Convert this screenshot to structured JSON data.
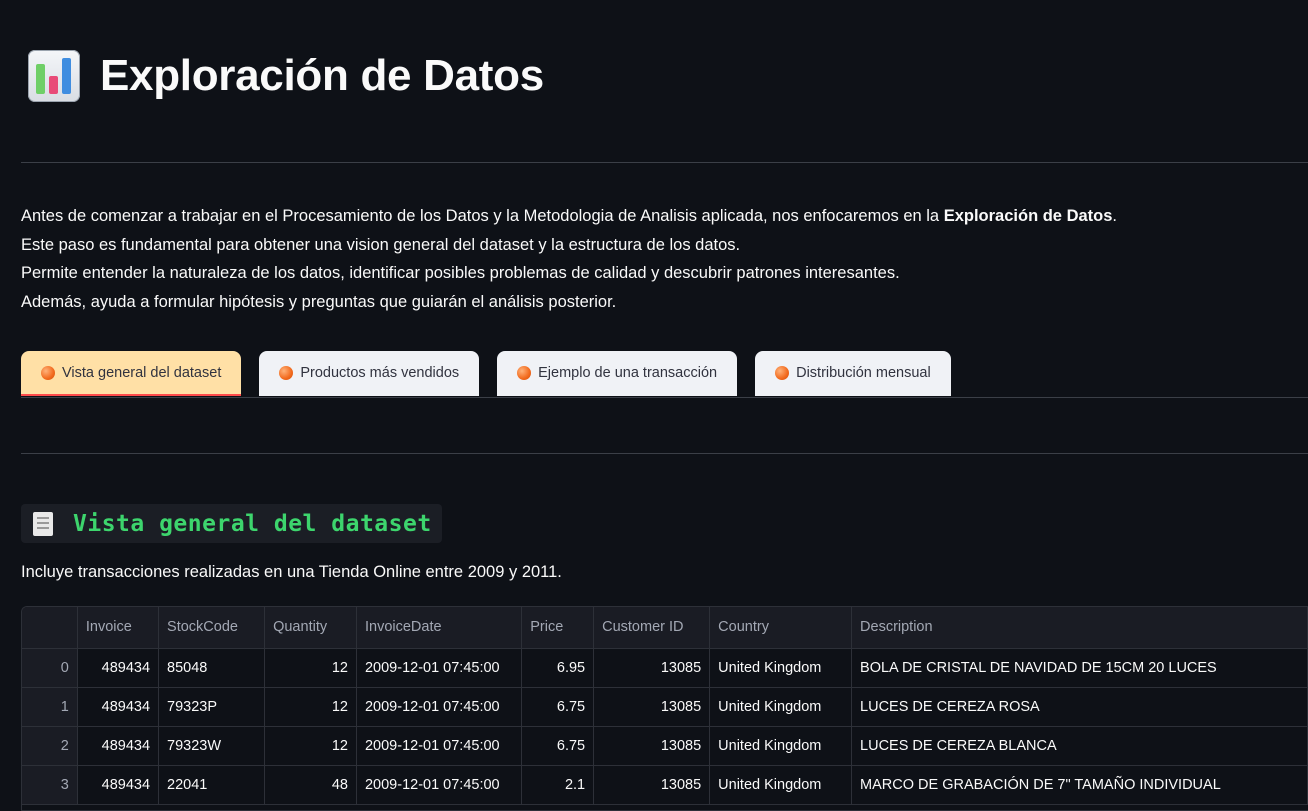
{
  "header": {
    "title": "Exploración de Datos",
    "icon": "bar-chart-icon"
  },
  "intro": {
    "line1_pre": "Antes de comenzar a trabajar en el Procesamiento de los Datos y la Metodologia de Analisis aplicada, nos enfocaremos en la ",
    "line1_bold": "Exploración de Datos",
    "line1_post": ".",
    "line2": "Este paso es fundamental para obtener una vision general del dataset y la estructura de los datos.",
    "line3": "Permite entender la naturaleza de los datos, identificar posibles problemas de calidad y descubrir patrones interesantes.",
    "line4": "Además, ayuda a formular hipótesis y preguntas que guiarán el análisis posterior."
  },
  "tabs": [
    {
      "label": "Vista general del dataset",
      "active": true
    },
    {
      "label": "Productos más vendidos",
      "active": false
    },
    {
      "label": "Ejemplo de una transacción",
      "active": false
    },
    {
      "label": "Distribución mensual",
      "active": false
    }
  ],
  "section": {
    "title": "Vista general del dataset",
    "icon": "receipt-icon",
    "caption": "Incluye transacciones realizadas en una Tienda Online entre 2009 y 2011."
  },
  "table": {
    "columns": [
      "",
      "Invoice",
      "StockCode",
      "Quantity",
      "InvoiceDate",
      "Price",
      "Customer ID",
      "Country",
      "Description"
    ],
    "rows": [
      [
        "0",
        "489434",
        "85048",
        "12",
        "2009-12-01 07:45:00",
        "6.95",
        "13085",
        "United Kingdom",
        "BOLA DE CRISTAL DE NAVIDAD DE 15CM 20 LUCES"
      ],
      [
        "1",
        "489434",
        "79323P",
        "12",
        "2009-12-01 07:45:00",
        "6.75",
        "13085",
        "United Kingdom",
        "LUCES DE CEREZA ROSA"
      ],
      [
        "2",
        "489434",
        "79323W",
        "12",
        "2009-12-01 07:45:00",
        "6.75",
        "13085",
        "United Kingdom",
        "LUCES DE CEREZA BLANCA"
      ],
      [
        "3",
        "489434",
        "22041",
        "48",
        "2009-12-01 07:45:00",
        "2.1",
        "13085",
        "United Kingdom",
        "MARCO DE GRABACIÓN DE 7\" TAMAÑO INDIVIDUAL"
      ]
    ]
  },
  "colors": {
    "background": "#0e1117",
    "active_tab": "#ffe0a6",
    "accent": "#ff4b4b",
    "section_title": "#3dd56d"
  }
}
